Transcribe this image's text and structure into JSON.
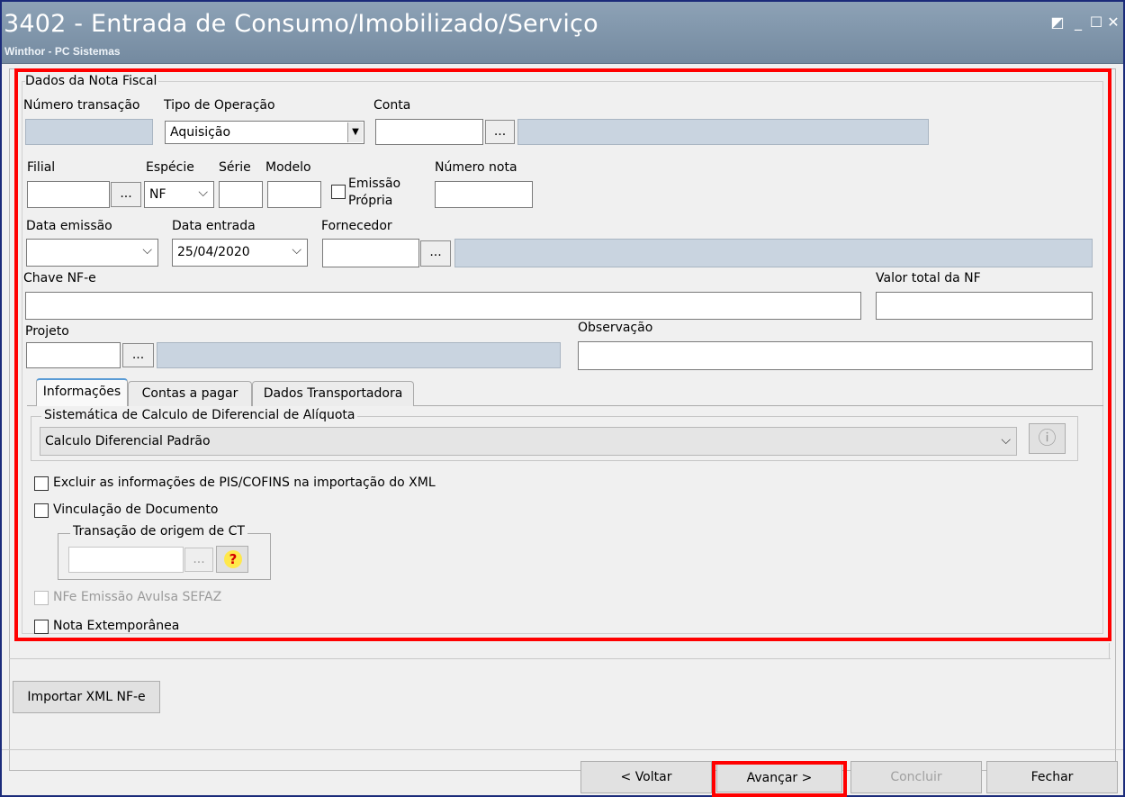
{
  "window": {
    "title": "3402 - Entrada de Consumo/Imobilizado/Serviço",
    "subtitle": "Winthor - PC Sistemas"
  },
  "form": {
    "group_title": "Dados da Nota Fiscal",
    "numero_transacao_label": "Número transação",
    "numero_transacao_value": "",
    "tipo_operacao_label": "Tipo de Operação",
    "tipo_operacao_value": "Aquisição",
    "conta_label": "Conta",
    "conta_value": "",
    "filial_label": "Filial",
    "especie_label": "Espécie",
    "especie_value": "NF",
    "serie_label": "Série",
    "modelo_label": "Modelo",
    "emissao_propria_label_1": "Emissão",
    "emissao_propria_label_2": "Própria",
    "numero_nota_label": "Número nota",
    "data_emissao_label": "Data emissão",
    "data_emissao_value": "",
    "data_entrada_label": "Data entrada",
    "data_entrada_value": "25/04/2020",
    "fornecedor_label": "Fornecedor",
    "chave_nfe_label": "Chave NF-e",
    "valor_total_label": "Valor total da NF",
    "projeto_label": "Projeto",
    "observacao_label": "Observação",
    "dots_label": "..."
  },
  "tabs": [
    {
      "label": "Informações",
      "active": true
    },
    {
      "label": "Contas a pagar",
      "active": false
    },
    {
      "label": "Dados Transportadora",
      "active": false
    }
  ],
  "informacoes": {
    "sistematica_group_title": "Sistemática de Calculo de Diferencial de Alíquota",
    "sistematica_value": "Calculo Diferencial Padrão",
    "excluir_pis_cofins_label": "Excluir as informações de PIS/COFINS na importação do XML",
    "vinculacao_label": "Vinculação de Documento",
    "transacao_origem_title": "Transação de origem de CT",
    "nfe_avulsa_label": "NFe Emissão Avulsa SEFAZ",
    "nota_extemporanea_label": "Nota Extemporânea"
  },
  "buttons": {
    "importar_xml": "Importar XML NF-e",
    "voltar": "< Voltar",
    "avancar": "Avançar >",
    "concluir": "Concluir",
    "fechar": "Fechar"
  },
  "colors": {
    "highlight": "#ff0000",
    "titlebar": "#7f95aa",
    "readonly_field": "#c9d4e0"
  }
}
